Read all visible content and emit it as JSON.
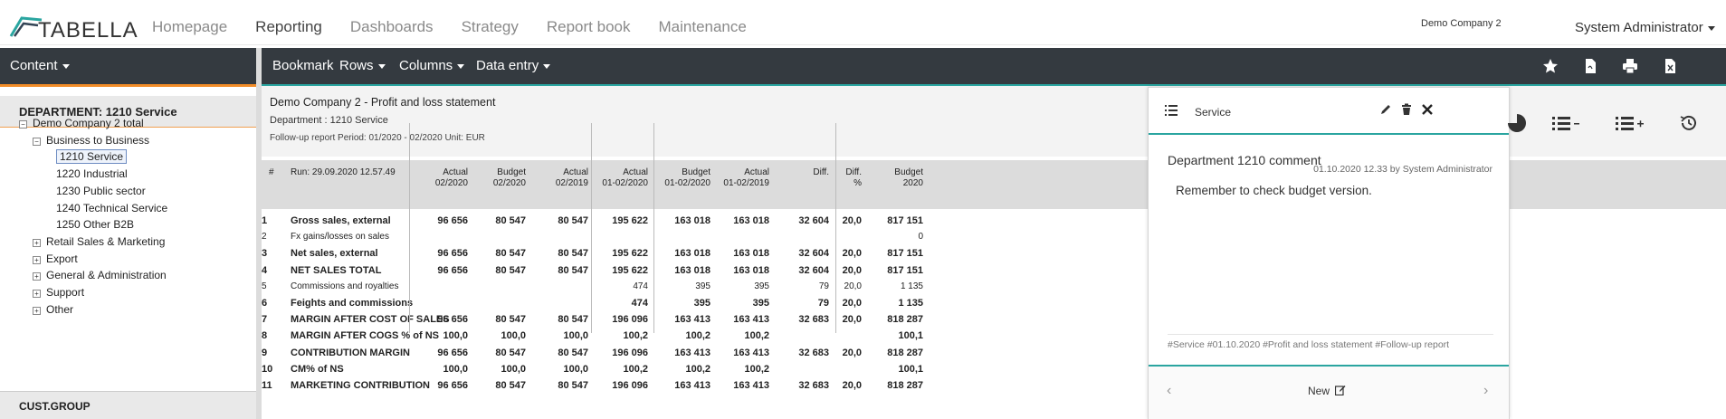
{
  "app": {
    "logo_text": "TABELLA",
    "company": "Demo Company 2",
    "user": "System Administrator",
    "nav": [
      "Homepage",
      "Reporting",
      "Dashboards",
      "Strategy",
      "Report book",
      "Maintenance"
    ],
    "active_nav": "Reporting"
  },
  "sidebar": {
    "content_label": "Content",
    "dept_header": "DEPARTMENT: 1210 Service",
    "tree": [
      {
        "label": "Demo Company 2 total",
        "level": 0,
        "toggle": "−"
      },
      {
        "label": "Business to Business",
        "level": 1,
        "toggle": "−"
      },
      {
        "label": "1210 Service",
        "level": 2,
        "toggle": ""
      },
      {
        "label": "1220 Industrial",
        "level": 2,
        "toggle": ""
      },
      {
        "label": "1230 Public sector",
        "level": 2,
        "toggle": ""
      },
      {
        "label": "1240 Technical Service",
        "level": 2,
        "toggle": ""
      },
      {
        "label": "1250 Other B2B",
        "level": 2,
        "toggle": ""
      },
      {
        "label": "Retail Sales & Marketing",
        "level": 1,
        "toggle": "+"
      },
      {
        "label": "Export",
        "level": 1,
        "toggle": "+"
      },
      {
        "label": "General & Administration",
        "level": 1,
        "toggle": "+"
      },
      {
        "label": "Support",
        "level": 1,
        "toggle": "+"
      },
      {
        "label": "Other",
        "level": 1,
        "toggle": "+"
      }
    ],
    "cust_header": "CUST.GROUP"
  },
  "toolbar": {
    "bookmark": "Bookmark",
    "rows": "Rows",
    "columns": "Columns",
    "data_entry": "Data entry"
  },
  "report": {
    "title": "Demo Company 2 - Profit and loss statement",
    "department": "Department : 1210 Service",
    "period": "Follow-up report Period: 01/2020 - 02/2020 Unit: EUR",
    "hash": "#",
    "run": "Run: 29.09.2020 12.57.49",
    "columns": [
      "Actual\n02/2020",
      "Budget\n02/2020",
      "Actual\n02/2019",
      "Actual\n01-02/2020",
      "Budget\n01-02/2020",
      "Actual\n01-02/2019",
      "Diff.",
      "Diff.\n%",
      "Budget\n2020"
    ],
    "rows": [
      {
        "n": "1",
        "label": "Gross sales, external",
        "bold": true,
        "v": [
          "96 656",
          "80 547",
          "80 547",
          "195 622",
          "163 018",
          "163 018",
          "32 604",
          "20,0",
          "817 151"
        ]
      },
      {
        "n": "2",
        "label": "Fx gains/losses on sales",
        "bold": false,
        "v": [
          "",
          "",
          "",
          "",
          "",
          "",
          "",
          "",
          "0"
        ]
      },
      {
        "n": "3",
        "label": "Net sales, external",
        "bold": true,
        "v": [
          "96 656",
          "80 547",
          "80 547",
          "195 622",
          "163 018",
          "163 018",
          "32 604",
          "20,0",
          "817 151"
        ]
      },
      {
        "n": "4",
        "label": "NET SALES TOTAL",
        "bold": true,
        "v": [
          "96 656",
          "80 547",
          "80 547",
          "195 622",
          "163 018",
          "163 018",
          "32 604",
          "20,0",
          "817 151"
        ]
      },
      {
        "n": "5",
        "label": "Commissions and royalties",
        "bold": false,
        "v": [
          "",
          "",
          "",
          "474",
          "395",
          "395",
          "79",
          "20,0",
          "1 135"
        ]
      },
      {
        "n": "6",
        "label": "Feights and commissions",
        "bold": true,
        "v": [
          "",
          "",
          "",
          "474",
          "395",
          "395",
          "79",
          "20,0",
          "1 135"
        ]
      },
      {
        "n": "7",
        "label": "MARGIN AFTER COST OF SALES",
        "bold": true,
        "v": [
          "96 656",
          "80 547",
          "80 547",
          "196 096",
          "163 413",
          "163 413",
          "32 683",
          "20,0",
          "818 287"
        ]
      },
      {
        "n": "8",
        "label": "MARGIN AFTER COGS % of NS",
        "bold": true,
        "v": [
          "100,0",
          "100,0",
          "100,0",
          "100,2",
          "100,2",
          "100,2",
          "",
          "",
          "100,1"
        ]
      },
      {
        "n": "9",
        "label": "CONTRIBUTION MARGIN",
        "bold": true,
        "v": [
          "96 656",
          "80 547",
          "80 547",
          "196 096",
          "163 413",
          "163 413",
          "32 683",
          "20,0",
          "818 287"
        ]
      },
      {
        "n": "10",
        "label": "CM% of NS",
        "bold": true,
        "v": [
          "100,0",
          "100,0",
          "100,0",
          "100,2",
          "100,2",
          "100,2",
          "",
          "",
          "100,1"
        ]
      },
      {
        "n": "11",
        "label": "MARKETING CONTRIBUTION",
        "bold": true,
        "v": [
          "96 656",
          "80 547",
          "80 547",
          "196 096",
          "163 413",
          "163 413",
          "32 683",
          "20,0",
          "818 287"
        ]
      }
    ]
  },
  "comment_panel": {
    "title": "Service",
    "comment_title": "Department 1210 comment",
    "meta": "01.10.2020 12.33 by System Administrator",
    "text": "Remember to check budget version.",
    "tags": "#Service #01.10.2020 #Profit and loss statement #Follow-up report",
    "new_label": "New"
  },
  "colors": {
    "toolbar_bg": "#343a40",
    "accent_teal": "#2aa5a0",
    "accent_orange": "#f28c28"
  }
}
